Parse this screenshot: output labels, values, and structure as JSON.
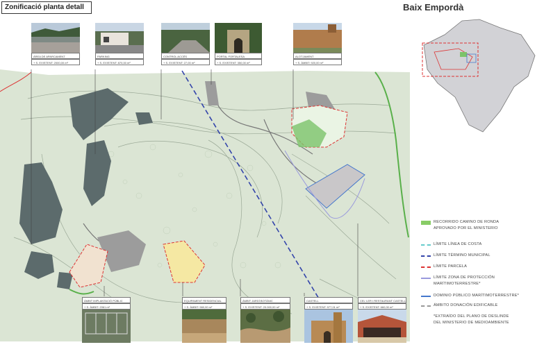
{
  "title": "Zonificació planta detall",
  "region_title": "Baix Empordà",
  "photos_top": [
    {
      "caption": "ÀREA DE APARCAMENT",
      "sub": "+ S. EXISTENT: 2000,00 m²"
    },
    {
      "caption": "PARKING",
      "sub": "+ S. EXISTENT: 870,00 m²"
    },
    {
      "caption": "CONTROL ACCÉS",
      "sub": "+ S. EXISTENT: 27,00 m²"
    },
    {
      "caption": "PORTAL FORTALESA",
      "sub": "+ S. EXISTENT: 350,00 m²"
    },
    {
      "caption": "ALOTJAMENT",
      "sub": "+ S. ÀMBIT: 920,00 m²"
    }
  ],
  "photos_bottom": [
    {
      "caption": "ÀMBIT IMPLANTACIÓ PÚBLIC",
      "sub": "+ S. ÀMBIT: 2061 m²"
    },
    {
      "caption": "EQUIPAMENT RESIDENCIAL",
      "sub": "+ S. ÀMBIT: 560,00 m²"
    },
    {
      "caption": "ÀMBIT JARDÍ BOTÀNIC",
      "sub": "+ S. EXISTENT: 20.000,00 m²"
    },
    {
      "caption": "CASTELL",
      "sub": "+ S. EXISTENT: 977,01 m²"
    },
    {
      "caption": "CEL·LER I RESTAURANT CASTELL",
      "sub": "+ S. EXISTENT: 660,00 m²"
    }
  ],
  "legend": [
    {
      "text": "RECORRIDO CAMINO DE RONDA",
      "text2": "APROVADO POR EL MINISTERIO",
      "color": "#88cc66",
      "style": "band"
    },
    {
      "text": "LÍMITE LÍNEA DE COSTA",
      "color": "#66cccc",
      "style": "dash"
    },
    {
      "text": "LÍMITE TÉRMINO MUNICIPAL",
      "color": "#3344aa",
      "style": "dash"
    },
    {
      "text": "LÍMITE PARCELA",
      "color": "#dd3333",
      "style": "dash"
    },
    {
      "text": "LÍMITE ZONA DE PROTECCIÓN",
      "text2": "MARÍTIMOTERRESTRE*",
      "color": "#9999dd",
      "style": "solid"
    },
    {
      "text": "DOMINIO PÚBLICO MARÍTIMOTERRESTRE*",
      "color": "#4477cc",
      "style": "solid"
    },
    {
      "text": "ÁMBITO DONACIÓN EDIFICABLE",
      "color": "#999999",
      "style": "dash"
    },
    {
      "text": "*EXTRAÍDO DEL PLANO DE DESLINDE",
      "text2": "DEL MINISTERIO DE MEDIOAMBIENTE",
      "color": "",
      "style": "none"
    }
  ]
}
